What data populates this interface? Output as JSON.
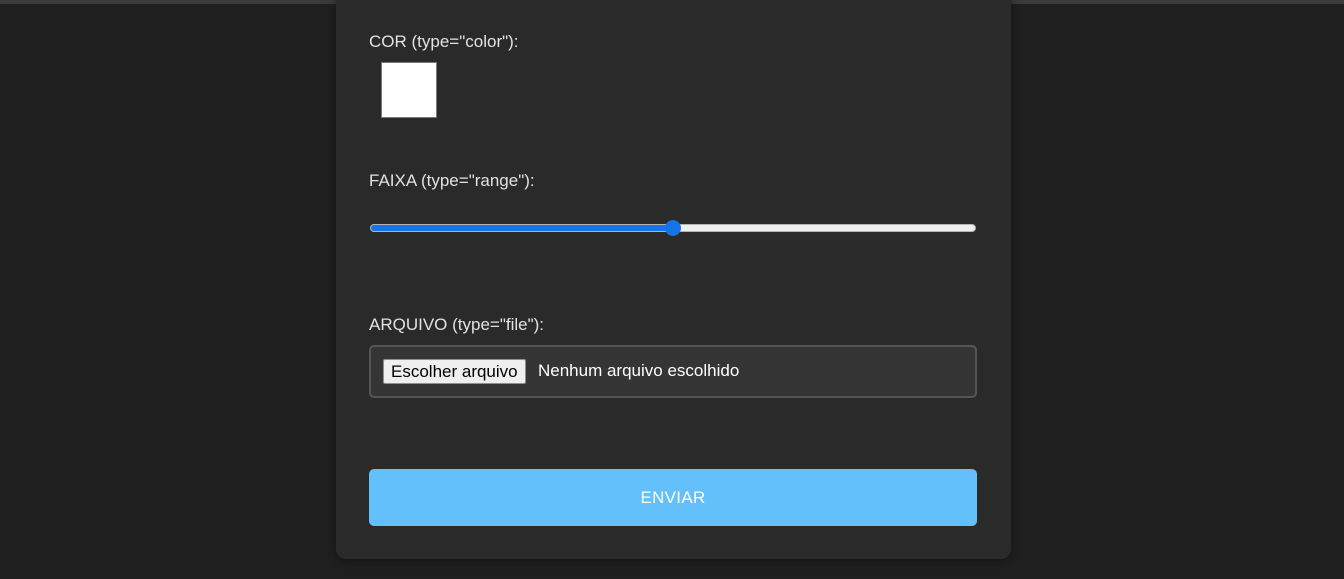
{
  "form": {
    "color": {
      "label": "COR (type=\"color\"):",
      "value": "#ffffff"
    },
    "range": {
      "label": "FAIXA (type=\"range\"):",
      "value": 50,
      "min": 0,
      "max": 100,
      "fill_color": "#1473e6"
    },
    "file": {
      "label": "ARQUIVO (type=\"file\"):",
      "button_label": "Escolher arquivo",
      "status": "Nenhum arquivo escolhido"
    },
    "submit": {
      "label": "ENVIAR",
      "color": "#64c0fb"
    }
  }
}
